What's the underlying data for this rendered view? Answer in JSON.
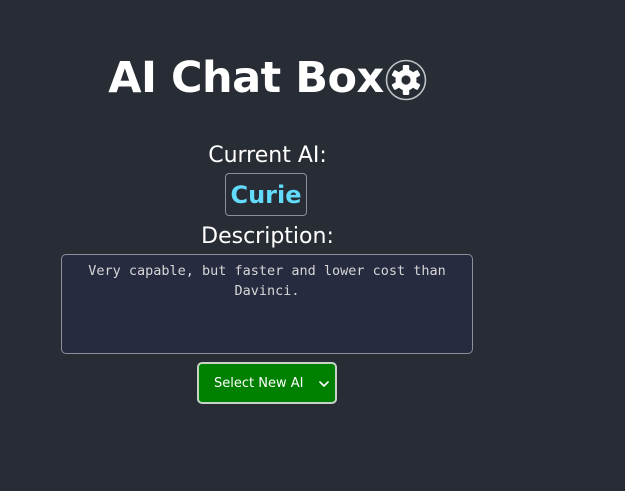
{
  "header": {
    "title": "AI Chat Box",
    "settings_icon": "gear-icon"
  },
  "current_ai": {
    "label": "Current AI:",
    "name": "Curie"
  },
  "description": {
    "label": "Description:",
    "text": "Very capable, but faster and lower cost than Davinci."
  },
  "selector": {
    "selected_label": "Select New AI",
    "icon": "chevron-down-icon"
  },
  "colors": {
    "background": "#282c34",
    "accent": "#61dafb",
    "button": "#008000"
  }
}
